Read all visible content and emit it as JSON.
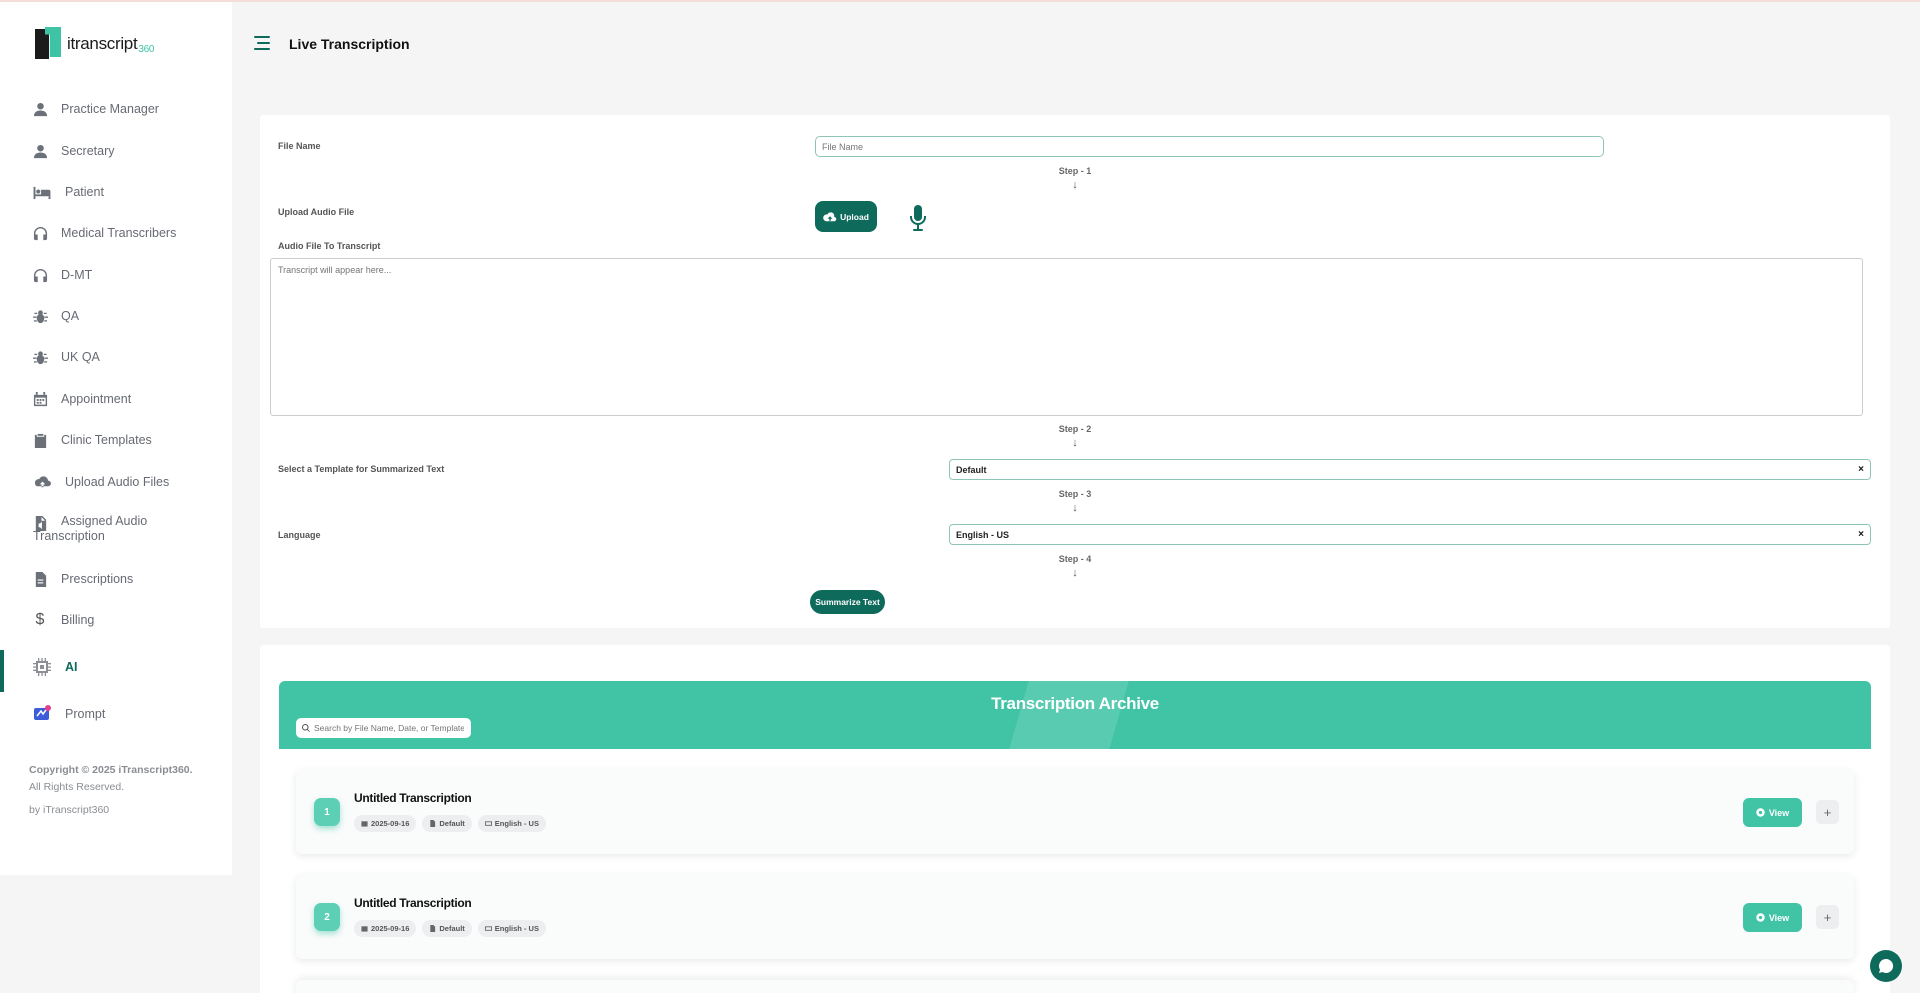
{
  "app": {
    "logo_text": "itranscript",
    "logo_sub": "360",
    "page_title": "Live Transcription"
  },
  "sidebar": {
    "items": [
      {
        "label": "Practice Manager",
        "icon": "user-icon"
      },
      {
        "label": "Secretary",
        "icon": "user-icon"
      },
      {
        "label": "Patient",
        "icon": "bed-icon"
      },
      {
        "label": "Medical Transcribers",
        "icon": "headset-icon"
      },
      {
        "label": "D-MT",
        "icon": "headset-icon"
      },
      {
        "label": "QA",
        "icon": "bug-icon"
      },
      {
        "label": "UK QA",
        "icon": "bug-icon"
      },
      {
        "label": "Appointment",
        "icon": "calendar-icon"
      },
      {
        "label": "Clinic Templates",
        "icon": "clipboard-icon"
      },
      {
        "label": "Upload Audio Files",
        "icon": "cloud-upload-icon"
      },
      {
        "label": "Assigned Audio Transcription",
        "icon": "file-audio-icon"
      },
      {
        "label": "Prescriptions",
        "icon": "file-icon"
      },
      {
        "label": "Billing",
        "icon": "dollar-icon"
      },
      {
        "label": "AI",
        "icon": "chip-icon",
        "active": true
      },
      {
        "label": "Prompt",
        "icon": "prompt-icon"
      }
    ],
    "copyright": "Copyright © 2025 iTranscript360.",
    "rights": "All Rights Reserved.",
    "by": "by iTranscript360"
  },
  "form": {
    "file_name_label": "File Name",
    "file_name_placeholder": "File Name",
    "file_name_value": "",
    "step1": "Step - 1",
    "upload_label": "Upload Audio File",
    "upload_button": "Upload",
    "audio_label": "Audio File To Transcript",
    "transcript_placeholder": "Transcript will appear here...",
    "step2": "Step - 2",
    "template_label": "Select a Template for Summarized Text",
    "template_value": "Default",
    "step3": "Step - 3",
    "language_label": "Language",
    "language_value": "English - US",
    "step4": "Step - 4",
    "summarize_button": "Summarize Text",
    "arrow": "↓",
    "clear": "×"
  },
  "archive": {
    "title": "Transcription Archive",
    "search_placeholder": "Search by File Name, Date, or Template",
    "view_label": "View",
    "plus_label": "+",
    "rows": [
      {
        "index": "1",
        "title": "Untitled Transcription",
        "date": "2025-09-16",
        "template": "Default",
        "language": "English - US"
      },
      {
        "index": "2",
        "title": "Untitled Transcription",
        "date": "2025-09-16",
        "template": "Default",
        "language": "English - US"
      }
    ]
  },
  "colors": {
    "primary": "#0e6b5c",
    "accent": "#41c4a6",
    "background": "#f5f5f6"
  }
}
